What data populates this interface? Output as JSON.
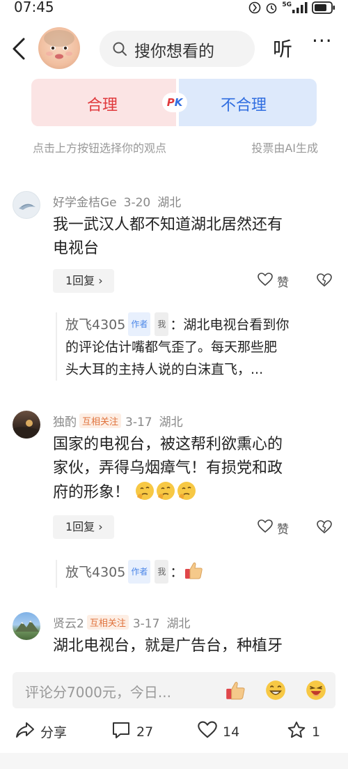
{
  "status_bar": {
    "time": "07:45",
    "network": "5G"
  },
  "header": {
    "search_placeholder": "搜你想看的",
    "listen_label": "听",
    "more_label": "···"
  },
  "pk": {
    "left_label": "合理",
    "badge_p": "P",
    "badge_k": "K",
    "right_label": "不合理",
    "hint_left": "点击上方按钮选择你的观点",
    "hint_right": "投票由AI生成"
  },
  "comments": [
    {
      "user": "好学金桔Ge",
      "date": "3-20",
      "location": "湖北",
      "lines": [
        "我一武汉人都不知道湖北居然还有",
        "电视台"
      ],
      "reply_label": "1回复 ›",
      "like_label": "赞",
      "sub_reply": {
        "name": "放飞4305",
        "author_tag": "作者",
        "me_tag": "我",
        "lines": [
          "：湖北电视台看到你",
          "的评论估计嘴都气歪了。每天那些肥",
          "头大耳的主持人说的白沫直飞，..."
        ]
      }
    },
    {
      "user": "独酌",
      "badge": "互相关注",
      "date": "3-17",
      "location": "湖北",
      "lines": [
        "国家的电视台，被这帮利欲熏心的",
        "家伙，弄得乌烟瘴气！有损党和政",
        "府的形象！"
      ],
      "reply_label": "1回复 ›",
      "like_label": "赞",
      "sub_reply": {
        "name": "放飞4305",
        "author_tag": "作者",
        "me_tag": "我",
        "text": "："
      }
    },
    {
      "user": "贤云2",
      "badge": "互相关注",
      "date": "3-17",
      "location": "湖北",
      "lines": [
        "湖北电视台，就是广告台，种植牙"
      ]
    }
  ],
  "input": {
    "placeholder": "评论分7000元，今日..."
  },
  "bottom_bar": {
    "share_label": "分享",
    "comment_count": "27",
    "like_count": "14",
    "favorite_count": "1"
  }
}
